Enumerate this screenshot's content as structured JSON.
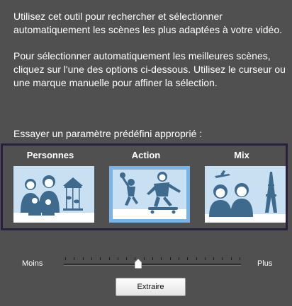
{
  "intro_text": "Utilisez cet outil pour rechercher et sélectionner automatiquement les scènes les plus adaptées à votre vidéo.",
  "instruction_text": "Pour sélectionner automatiquement les meilleures scènes, cliquez sur l'une des options ci-dessous. Utilisez le curseur ou une marque manuelle pour affiner la sélection.",
  "preset_prompt": "Essayer un paramètre prédéfini approprié :",
  "options": [
    {
      "label": "Personnes",
      "selected": false,
      "icon": "family-carousel-illustration"
    },
    {
      "label": "Action",
      "selected": true,
      "icon": "sports-skateboard-illustration"
    },
    {
      "label": "Mix",
      "selected": false,
      "icon": "travel-eiffel-tower-illustration"
    }
  ],
  "slider": {
    "min_label": "Moins",
    "max_label": "Plus",
    "value": 0.42
  },
  "extract_button": "Extraire",
  "colors": {
    "background": "#505050",
    "panel_border": "#2a1f3d",
    "illustration": "#3e6a8e",
    "illustration_bg": "#c8e0f2",
    "selected_border": "#79b4e8"
  }
}
